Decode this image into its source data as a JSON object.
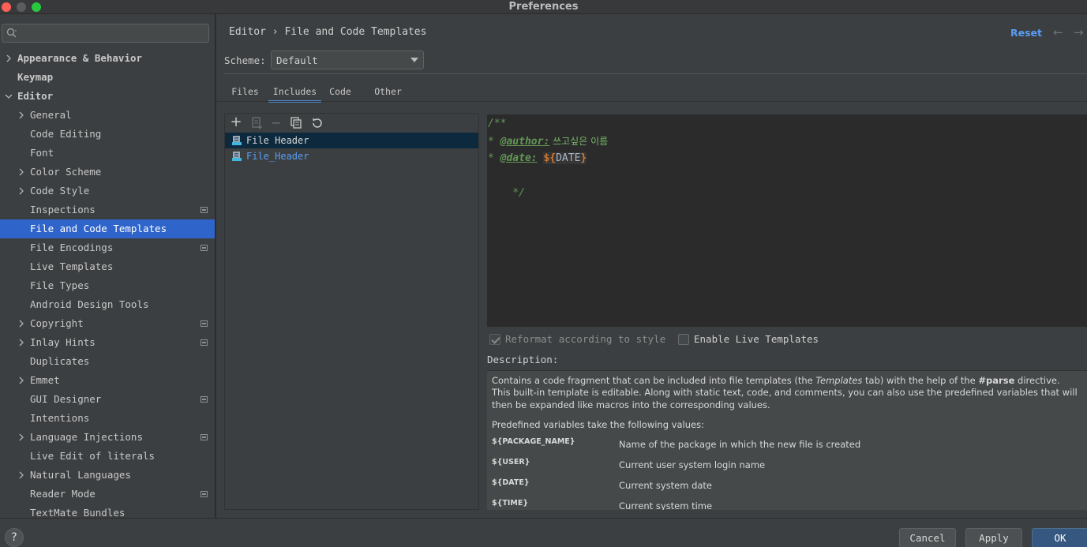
{
  "window": {
    "title": "Preferences"
  },
  "search": {
    "placeholder": ""
  },
  "sidebar": {
    "items": [
      {
        "label": "Appearance & Behavior",
        "expandable": true,
        "expanded": false,
        "level": 0,
        "bold": true
      },
      {
        "label": "Keymap",
        "expandable": false,
        "level": 0,
        "bold": true
      },
      {
        "label": "Editor",
        "expandable": true,
        "expanded": true,
        "level": 0,
        "bold": true
      },
      {
        "label": "General",
        "expandable": true,
        "expanded": false,
        "level": 1
      },
      {
        "label": "Code Editing",
        "expandable": false,
        "level": 1
      },
      {
        "label": "Font",
        "expandable": false,
        "level": 1
      },
      {
        "label": "Color Scheme",
        "expandable": true,
        "expanded": false,
        "level": 1
      },
      {
        "label": "Code Style",
        "expandable": true,
        "expanded": false,
        "level": 1
      },
      {
        "label": "Inspections",
        "expandable": false,
        "level": 1,
        "project": true
      },
      {
        "label": "File and Code Templates",
        "expandable": false,
        "level": 1,
        "selected": true
      },
      {
        "label": "File Encodings",
        "expandable": false,
        "level": 1,
        "project": true
      },
      {
        "label": "Live Templates",
        "expandable": false,
        "level": 1
      },
      {
        "label": "File Types",
        "expandable": false,
        "level": 1
      },
      {
        "label": "Android Design Tools",
        "expandable": false,
        "level": 1
      },
      {
        "label": "Copyright",
        "expandable": true,
        "expanded": false,
        "level": 1,
        "project": true
      },
      {
        "label": "Inlay Hints",
        "expandable": true,
        "expanded": false,
        "level": 1,
        "project": true
      },
      {
        "label": "Duplicates",
        "expandable": false,
        "level": 1
      },
      {
        "label": "Emmet",
        "expandable": true,
        "expanded": false,
        "level": 1
      },
      {
        "label": "GUI Designer",
        "expandable": false,
        "level": 1,
        "project": true
      },
      {
        "label": "Intentions",
        "expandable": false,
        "level": 1
      },
      {
        "label": "Language Injections",
        "expandable": true,
        "expanded": false,
        "level": 1,
        "project": true
      },
      {
        "label": "Live Edit of literals",
        "expandable": false,
        "level": 1
      },
      {
        "label": "Natural Languages",
        "expandable": true,
        "expanded": false,
        "level": 1
      },
      {
        "label": "Reader Mode",
        "expandable": false,
        "level": 1,
        "project": true
      },
      {
        "label": "TextMate Bundles",
        "expandable": false,
        "level": 1
      }
    ]
  },
  "header": {
    "breadcrumb": "Editor › File and Code Templates",
    "reset_label": "Reset",
    "back_glyph": "←",
    "forward_glyph": "→"
  },
  "scheme": {
    "label": "Scheme:",
    "value": "Default"
  },
  "tabs": [
    {
      "label": "Files",
      "active": false
    },
    {
      "label": "Includes",
      "active": true
    },
    {
      "label": "Code",
      "active": false
    },
    {
      "label": "Other",
      "active": false
    }
  ],
  "toolbar": {
    "add_glyph": "+",
    "remove_glyph": "−"
  },
  "templates": [
    {
      "label": "File Header",
      "selected": true,
      "color": "#d0d0d0"
    },
    {
      "label": "File_Header",
      "selected": false,
      "color": "#589df6"
    }
  ],
  "editor": {
    "line1": "/**",
    "line2_star": "* ",
    "line2_tag": "@author:",
    "line2_text": " 쓰고싶은 이름",
    "line3_star": "* ",
    "line3_tag": "@date:",
    "line3_space": " ",
    "line3_var_open": "${",
    "line3_var_name": "DATE",
    "line3_var_close": "}",
    "line4": "    */"
  },
  "options": {
    "reformat_label": "Reformat according to style",
    "reformat_checked": true,
    "live_templates_label": "Enable Live Templates",
    "live_templates_checked": false
  },
  "description": {
    "label": "Description:",
    "p1_a": "Contains a code fragment that can be included into file templates (the ",
    "p1_b": "Templates",
    "p1_c": " tab) with the help of the ",
    "p1_d": "#parse",
    "p1_e": " directive.",
    "p2": "This built-in template is editable. Along with static text, code, and comments, you can also use the predefined variables that will then be expanded like macros into the corresponding values.",
    "p3": "Predefined variables take the following values:",
    "variables": [
      {
        "name": "${PACKAGE_NAME}",
        "desc": "Name of the package in which the new file is created"
      },
      {
        "name": "${USER}",
        "desc": "Current user system login name"
      },
      {
        "name": "${DATE}",
        "desc": "Current system date"
      },
      {
        "name": "${TIME}",
        "desc": "Current system time"
      }
    ]
  },
  "footer": {
    "help_label": "?",
    "cancel_label": "Cancel",
    "apply_label": "Apply",
    "ok_label": "OK"
  },
  "colors": {
    "selection": "#2f65ca",
    "link": "#589df6",
    "ok_button": "#365880",
    "comment": "#629755",
    "variable": "#cc7832"
  }
}
